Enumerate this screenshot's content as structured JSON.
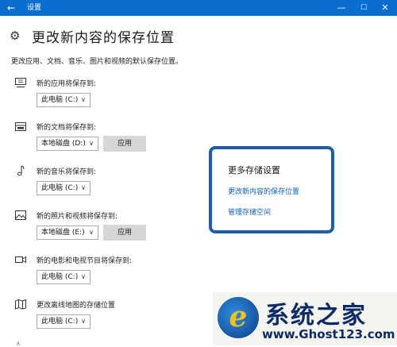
{
  "window": {
    "back_icon": "back-arrow-icon",
    "title": "设置",
    "minimize": "—",
    "maximize": "☐",
    "close": "✕",
    "accent": "#0a6dd0"
  },
  "page": {
    "icon": "gear-icon",
    "title": "更改新内容的保存位置",
    "description": "更改应用、文档、音乐、图片和视频的默认保存位置。"
  },
  "rows": [
    {
      "icon": "monitor-icon",
      "label": "新的应用将保存到:",
      "value": "此电脑 (C:)",
      "apply": ""
    },
    {
      "icon": "drive-icon",
      "label": "新的文档将保存到:",
      "value": "本地磁盘 (D:)",
      "apply": "应用"
    },
    {
      "icon": "music-note-icon",
      "label": "新的音乐将保存到:",
      "value": "此电脑 (C:)",
      "apply": ""
    },
    {
      "icon": "picture-icon",
      "label": "新的照片和视频将保存到:",
      "value": "本地磁盘 (E:)",
      "apply": "应用"
    },
    {
      "icon": "video-camera-icon",
      "label": "新的电影和电视节目将保存到:",
      "value": "此电脑 (C:)",
      "apply": ""
    },
    {
      "icon": "map-icon",
      "label": "更改离线地图的存储位置",
      "value": "此电脑 (C:)",
      "apply": ""
    }
  ],
  "side": {
    "title": "更多存储设置",
    "links": [
      "更改新内容的保存位置",
      "管理存储空间"
    ],
    "highlight": "#1f5ea3"
  },
  "watermark": {
    "text": "系统之家",
    "url": "www.Ghost123.com"
  }
}
